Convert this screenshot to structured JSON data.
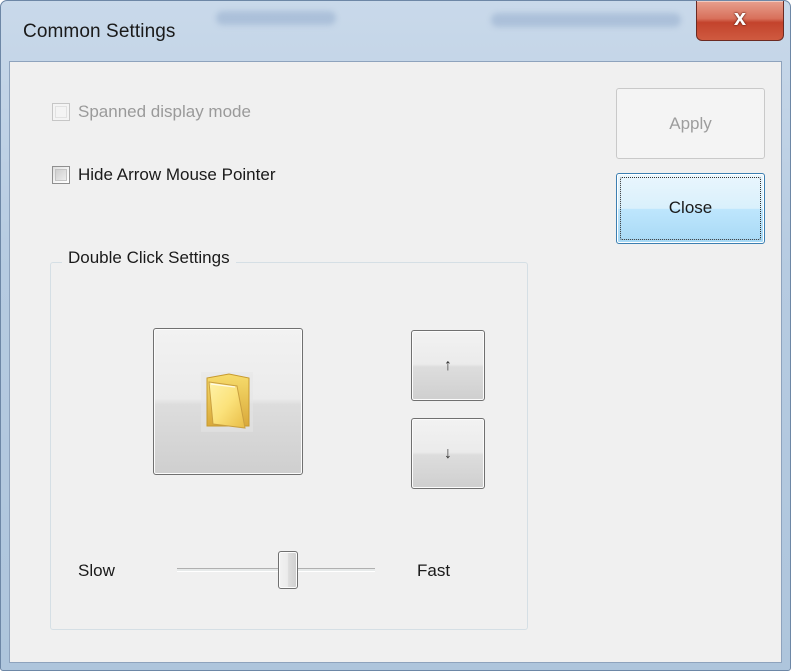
{
  "window": {
    "title": "Common Settings",
    "close_glyph": "x",
    "close_icon": "close-icon"
  },
  "options": {
    "spanned_display_mode": {
      "label": "Spanned display mode",
      "checked": false,
      "enabled": false
    },
    "hide_arrow_pointer": {
      "label": "Hide Arrow Mouse Pointer",
      "checked": false,
      "enabled": true
    }
  },
  "buttons": {
    "apply_label": "Apply",
    "apply_enabled": false,
    "close_label": "Close"
  },
  "double_click": {
    "group_label": "Double Click Settings",
    "test_icon": "folder-icon",
    "up_glyph": "↑",
    "down_glyph": "↓",
    "slow_label": "Slow",
    "fast_label": "Fast",
    "speed_fraction": 0.55
  },
  "colors": {
    "client_bg": "#f0f0f0",
    "close_button_accent": "#c3432c",
    "default_button_accent": "#3c7fb1"
  }
}
